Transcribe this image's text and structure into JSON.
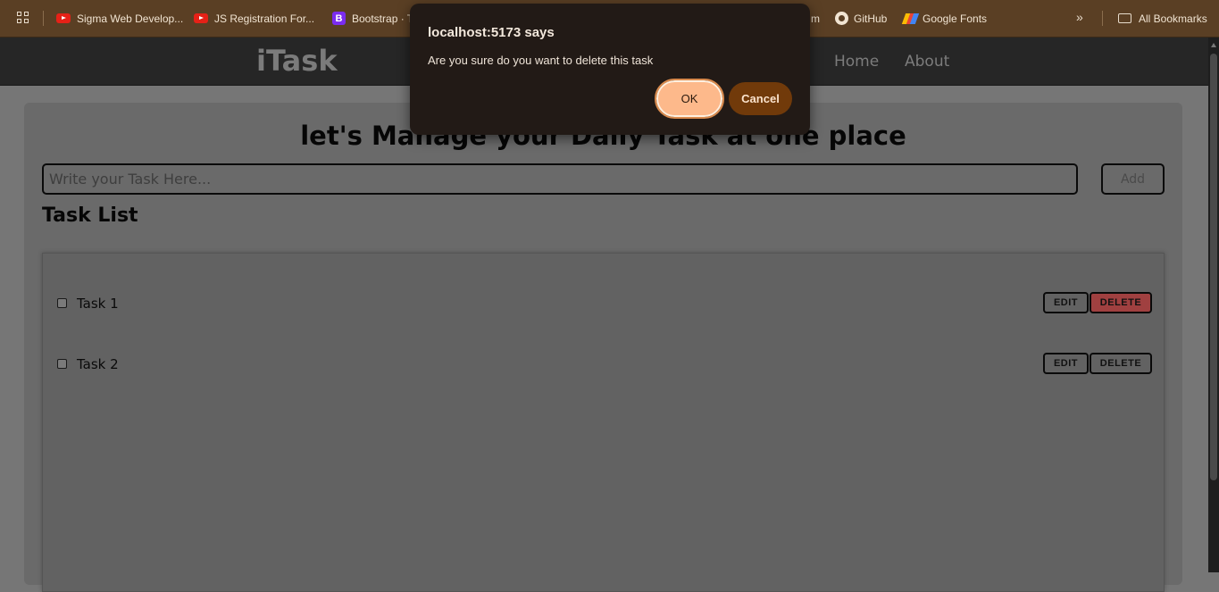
{
  "bookmarks": {
    "items": [
      {
        "label": "Sigma Web Develop...",
        "icon": "youtube-icon"
      },
      {
        "label": "JS Registration For...",
        "icon": "youtube-icon"
      },
      {
        "label": "Bootstrap · T",
        "icon": "bootstrap-icon",
        "glyph": "B"
      },
      {
        "label": "m",
        "icon": "partial-bookmark"
      },
      {
        "label": "GitHub",
        "icon": "github-icon"
      },
      {
        "label": "Google Fonts",
        "icon": "google-fonts-icon"
      }
    ],
    "overflow_glyph": "»",
    "all_bookmarks": "All Bookmarks"
  },
  "navbar": {
    "brand": "iTask",
    "links": [
      "Home",
      "About"
    ]
  },
  "main": {
    "heading": "let's Manage your Daily Task at one place",
    "input_placeholder": "Write your Task Here...",
    "add_label": "Add",
    "list_title": "Task List",
    "tasks": [
      {
        "text": "Task 1",
        "checked": false,
        "edit_label": "EDIT",
        "delete_label": "DELETE",
        "delete_highlighted": true
      },
      {
        "text": "Task 2",
        "checked": false,
        "edit_label": "EDIT",
        "delete_label": "DELETE",
        "delete_highlighted": false
      }
    ]
  },
  "dialog": {
    "title": "localhost:5173 says",
    "message": "Are you sure do you want to delete this task",
    "ok_label": "OK",
    "cancel_label": "Cancel"
  },
  "colors": {
    "delete_highlight": "#a04040",
    "ok_button": "#fdb98b",
    "cancel_button": "#713a0a",
    "bookmarks_bar": "#5a3f24"
  }
}
